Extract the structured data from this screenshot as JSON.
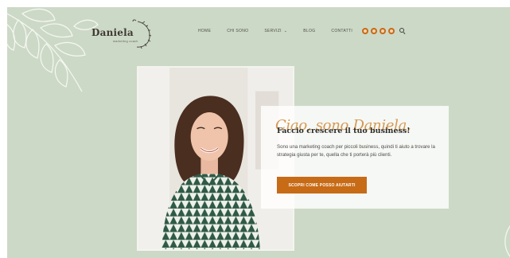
{
  "brand": {
    "name": "Daniela",
    "tagline": "marketing coach"
  },
  "nav": {
    "items": [
      {
        "label": "HOME"
      },
      {
        "label": "CHI SONO"
      },
      {
        "label": "SERVIZI",
        "has_dropdown": true
      },
      {
        "label": "BLOG"
      },
      {
        "label": "CONTATTI"
      }
    ],
    "dropdown_glyph": "⌄",
    "social_icons": [
      "social-icon-1",
      "social-icon-2",
      "social-icon-3",
      "social-icon-4"
    ],
    "search_icon": "search-icon"
  },
  "hero": {
    "script_greeting": "Ciao, sono Daniela,",
    "headline": "Faccio crescere il tuo business!",
    "intro": "Sono una marketing coach per piccoli business, quindi ti aiuto a trovare la strategia giusta per te, quella che ti porterà più clienti.",
    "cta_label": "SCOPRI COME POSSO AIUTARTI"
  },
  "colors": {
    "background": "#cdd9c7",
    "accent": "#c76b17",
    "script": "#d59a52",
    "card": "#ffffff"
  }
}
